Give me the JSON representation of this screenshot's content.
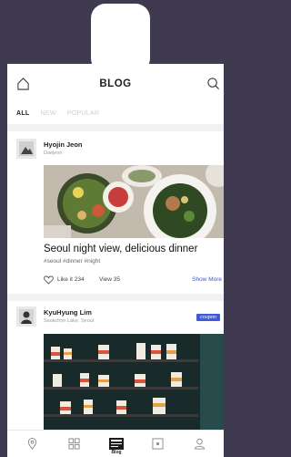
{
  "header": {
    "title": "BLOG"
  },
  "tabs": [
    {
      "label": "ALL",
      "active": true
    },
    {
      "label": "NEW",
      "active": false
    },
    {
      "label": "POPULAR",
      "active": false
    }
  ],
  "posts": [
    {
      "author": "Hyojin Jeon",
      "location": "Daejeon",
      "caption": "Seoul night view, delicious dinner",
      "tags": "#seoul #dinner #night",
      "likes": "Like it 234",
      "views": "View 35",
      "show_more": "Show More"
    },
    {
      "author": "KyuHyung Lim",
      "location": "Seokchon Lake, Seoul",
      "badge": "coupon"
    }
  ],
  "bottom_nav": [
    {
      "icon": "map-pin-icon",
      "label": ""
    },
    {
      "icon": "grid-icon",
      "label": ""
    },
    {
      "icon": "blog-icon",
      "label": "Blog",
      "active": true
    },
    {
      "icon": "square-icon",
      "label": ""
    },
    {
      "icon": "profile-icon",
      "label": ""
    }
  ],
  "colors": {
    "accent": "#3b5bd9",
    "background": "#3f3a4f"
  }
}
